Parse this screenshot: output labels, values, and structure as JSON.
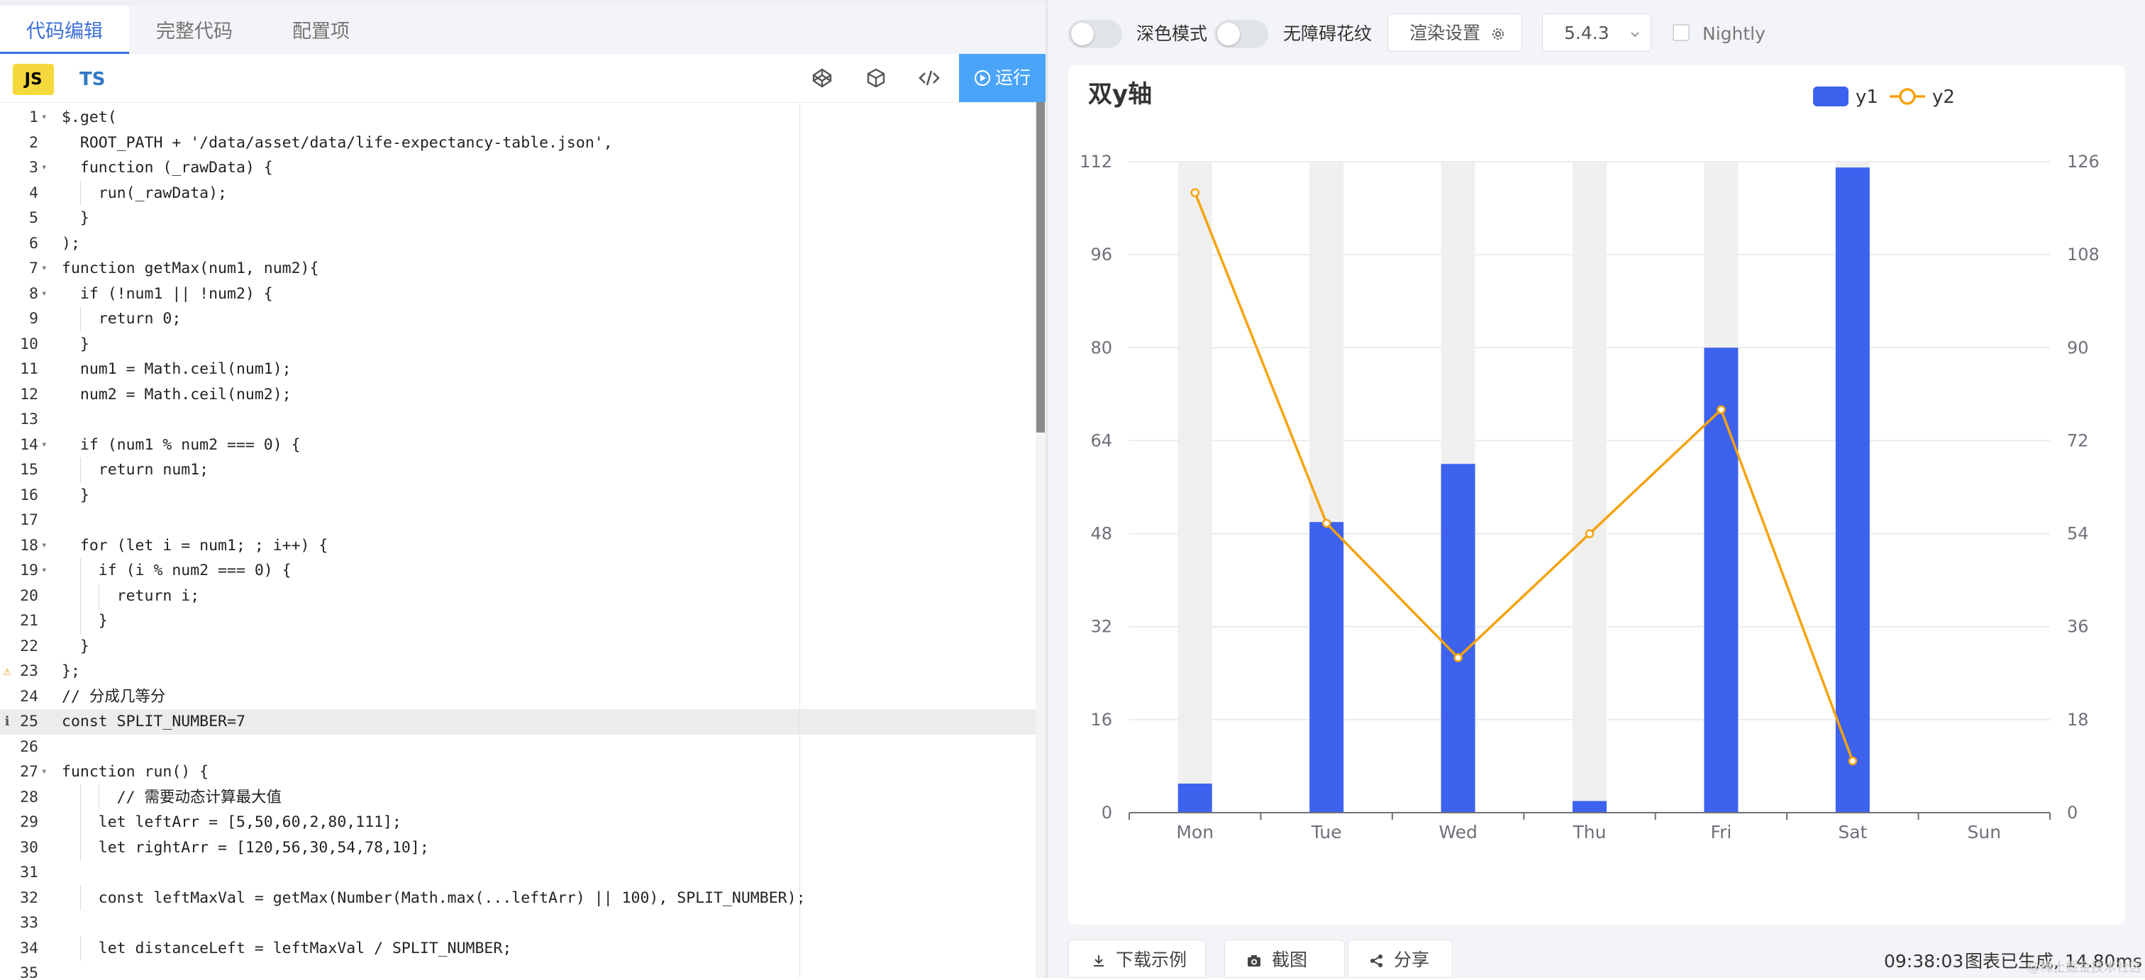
{
  "editor": {
    "tabs": [
      "代码编辑",
      "完整代码",
      "配置项"
    ],
    "lang_js": "JS",
    "lang_ts": "TS",
    "run_label": "运行",
    "lines": [
      {
        "n": "1",
        "t": "$.get(",
        "fold": true
      },
      {
        "n": "2",
        "t": "  ROOT_PATH + '/data/asset/data/life-expectancy-table.json',"
      },
      {
        "n": "3",
        "t": "  function (_rawData) {",
        "fold": true
      },
      {
        "n": "4",
        "t": "    run(_rawData);"
      },
      {
        "n": "5",
        "t": "  }"
      },
      {
        "n": "6",
        "t": ");"
      },
      {
        "n": "7",
        "t": "function getMax(num1, num2){",
        "fold": true
      },
      {
        "n": "8",
        "t": "  if (!num1 || !num2) {",
        "fold": true
      },
      {
        "n": "9",
        "t": "    return 0;"
      },
      {
        "n": "10",
        "t": "  }"
      },
      {
        "n": "11",
        "t": "  num1 = Math.ceil(num1);"
      },
      {
        "n": "12",
        "t": "  num2 = Math.ceil(num2);"
      },
      {
        "n": "13",
        "t": ""
      },
      {
        "n": "14",
        "t": "  if (num1 % num2 === 0) {",
        "fold": true
      },
      {
        "n": "15",
        "t": "    return num1;"
      },
      {
        "n": "16",
        "t": "  }"
      },
      {
        "n": "17",
        "t": ""
      },
      {
        "n": "18",
        "t": "  for (let i = num1; ; i++) {",
        "fold": true
      },
      {
        "n": "19",
        "t": "    if (i % num2 === 0) {",
        "fold": true
      },
      {
        "n": "20",
        "t": "      return i;"
      },
      {
        "n": "21",
        "t": "    }"
      },
      {
        "n": "22",
        "t": "  }"
      },
      {
        "n": "23",
        "t": "};",
        "mark": "warning"
      },
      {
        "n": "24",
        "t": "// 分成几等分"
      },
      {
        "n": "25",
        "t": "const SPLIT_NUMBER=7",
        "mark": "info",
        "hl": true
      },
      {
        "n": "26",
        "t": ""
      },
      {
        "n": "27",
        "t": "function run() {",
        "fold": true
      },
      {
        "n": "28",
        "t": "      // 需要动态计算最大值"
      },
      {
        "n": "29",
        "t": "    let leftArr = [5,50,60,2,80,111];"
      },
      {
        "n": "30",
        "t": "    let rightArr = [120,56,30,54,78,10];"
      },
      {
        "n": "31",
        "t": ""
      },
      {
        "n": "32",
        "t": "    const leftMaxVal = getMax(Number(Math.max(...leftArr) || 100), SPLIT_NUMBER);"
      },
      {
        "n": "33",
        "t": ""
      },
      {
        "n": "34",
        "t": "    let distanceLeft = leftMaxVal / SPLIT_NUMBER;"
      },
      {
        "n": "35",
        "t": ""
      }
    ]
  },
  "settings": {
    "dark_mode_label": "深色模式",
    "decal_label": "无障碍花纹",
    "render_settings_label": "渲染设置",
    "version": "5.4.3",
    "nightly_label": "Nightly"
  },
  "footer": {
    "download_label": "下载示例",
    "screenshot_label": "截图",
    "share_label": "分享",
    "time": "09:38:03",
    "status_text": "图表已生成, 14.80ms",
    "watermark": "@稀土掘金技术社区"
  },
  "colors": {
    "bar": "#3d62ee",
    "bar_background": "#efefef",
    "line": "#f6a20e",
    "accent": "#3b6fd6",
    "run_button": "#4aa5f9"
  },
  "chart_data": {
    "type": "bar",
    "title": "双y轴",
    "categories": [
      "Mon",
      "Tue",
      "Wed",
      "Thu",
      "Fri",
      "Sat",
      "Sun"
    ],
    "series": [
      {
        "name": "y1",
        "type": "bar",
        "axis": "left",
        "values": [
          5,
          50,
          60,
          2,
          80,
          111,
          null
        ],
        "show_background": true
      },
      {
        "name": "y2",
        "type": "line",
        "axis": "right",
        "values": [
          120,
          56,
          30,
          54,
          78,
          10,
          null
        ]
      }
    ],
    "y_left": {
      "min": 0,
      "max": 112,
      "ticks": [
        "0",
        "16",
        "32",
        "48",
        "64",
        "80",
        "96",
        "112"
      ]
    },
    "y_right": {
      "min": 0,
      "max": 126,
      "ticks": [
        "0",
        "18",
        "36",
        "54",
        "72",
        "90",
        "108",
        "126"
      ]
    },
    "legend": "top-right",
    "grid": true
  }
}
